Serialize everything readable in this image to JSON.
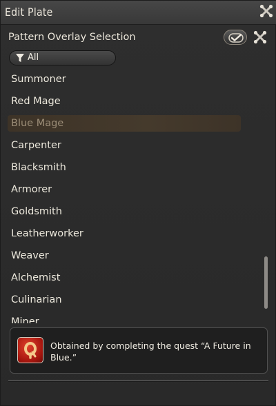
{
  "window": {
    "title": "Edit Plate",
    "close_icon": "close-icon"
  },
  "header": {
    "title": "Pattern Overlay Selection",
    "confirm_icon": "checkmark-icon",
    "reset_icon": "close-icon"
  },
  "filter": {
    "icon": "funnel-icon",
    "label": "All"
  },
  "list": {
    "items": [
      {
        "label": "Summoner",
        "selected": false
      },
      {
        "label": "Red Mage",
        "selected": false
      },
      {
        "label": "Blue Mage",
        "selected": true
      },
      {
        "label": "Carpenter",
        "selected": false
      },
      {
        "label": "Blacksmith",
        "selected": false
      },
      {
        "label": "Armorer",
        "selected": false
      },
      {
        "label": "Goldsmith",
        "selected": false
      },
      {
        "label": "Leatherworker",
        "selected": false
      },
      {
        "label": "Weaver",
        "selected": false
      },
      {
        "label": "Alchemist",
        "selected": false
      },
      {
        "label": "Culinarian",
        "selected": false
      },
      {
        "label": "Miner",
        "selected": false
      }
    ]
  },
  "info": {
    "icon": "quest-icon",
    "text": "Obtained by completing the quest “A Future in Blue.”"
  },
  "colors": {
    "background": "#2b2b2b",
    "selected_row": "#453a2c",
    "selected_text": "#9b8d77",
    "text": "#ece8dc",
    "quest_icon": "#c0241a"
  }
}
